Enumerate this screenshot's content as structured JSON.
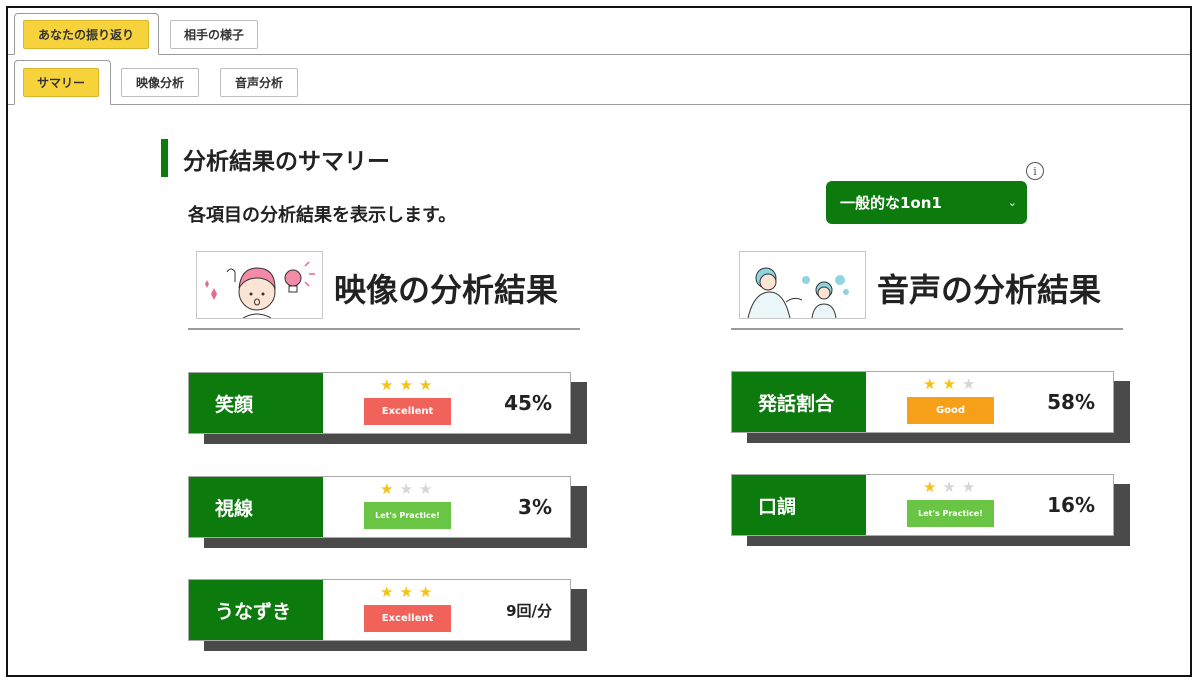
{
  "tabs_top": [
    {
      "label": "あなたの振り返り",
      "active": true
    },
    {
      "label": "相手の様子",
      "active": false
    }
  ],
  "tabs_sub": [
    {
      "label": "サマリー",
      "active": true
    },
    {
      "label": "映像分析",
      "active": false
    },
    {
      "label": "音声分析",
      "active": false
    }
  ],
  "summary": {
    "title": "分析結果のサマリー",
    "description": "各項目の分析結果を表示します。",
    "info_icon": "i",
    "dropdown_value": "一般的な1on1"
  },
  "video": {
    "title": "映像の分析結果",
    "items": [
      {
        "label": "笑顔",
        "stars": 3,
        "rating": "Excellent",
        "value": "45%"
      },
      {
        "label": "視線",
        "stars": 1,
        "rating": "Let's Practice!",
        "value": "3%"
      },
      {
        "label": "うなずき",
        "stars": 3,
        "rating": "Excellent",
        "value": "9回/分"
      }
    ]
  },
  "audio": {
    "title": "音声の分析結果",
    "items": [
      {
        "label": "発話割合",
        "stars": 2,
        "rating": "Good",
        "value": "58%"
      },
      {
        "label": "口調",
        "stars": 1,
        "rating": "Let's Practice!",
        "value": "16%"
      }
    ]
  },
  "colors": {
    "accent_green": "#0d7a0d",
    "tab_yellow": "#f6d33a",
    "excellent": "#f0625a",
    "good": "#f6a01a",
    "practice": "#6bc544",
    "star_on": "#f6c21a",
    "star_off": "#d6d6d6"
  }
}
